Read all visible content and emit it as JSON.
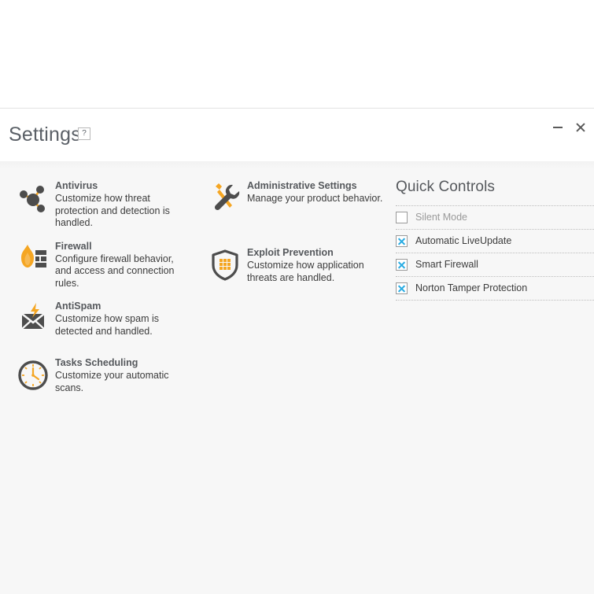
{
  "window": {
    "title": "Settings",
    "help_label": "?",
    "minimize_label": "Minimize",
    "close_label": "Close"
  },
  "settings": {
    "columns": [
      {
        "items": [
          {
            "icon": "molecule-icon",
            "title": "Antivirus",
            "description": "Customize how threat protection and detection is handled."
          },
          {
            "icon": "firewall-flame-brick-icon",
            "title": "Firewall",
            "description": "Configure firewall behavior, and access and connection rules."
          },
          {
            "icon": "envelope-lightning-icon",
            "title": "AntiSpam",
            "description": "Customize how spam is detected and handled."
          },
          {
            "icon": "clock-icon",
            "title": "Tasks Scheduling",
            "description": "Customize your automatic scans."
          }
        ]
      },
      {
        "items": [
          {
            "icon": "wrench-screwdriver-icon",
            "title": "Administrative Settings",
            "description": "Manage your product behavior."
          },
          {
            "icon": "shield-grid-icon",
            "title": "Exploit Prevention",
            "description": "Customize how application threats are handled."
          }
        ]
      }
    ]
  },
  "quick_controls": {
    "title": "Quick Controls",
    "items": [
      {
        "label": "Silent Mode",
        "checked": false
      },
      {
        "label": "Automatic LiveUpdate",
        "checked": true
      },
      {
        "label": "Smart Firewall",
        "checked": true
      },
      {
        "label": "Norton Tamper Protection",
        "checked": true
      }
    ]
  },
  "colors": {
    "accent_orange": "#f5a623",
    "icon_gray": "#595959",
    "checkbox_blue": "#29abe2",
    "content_background": "#f7f7f7",
    "title_text": "#5a5f66"
  }
}
